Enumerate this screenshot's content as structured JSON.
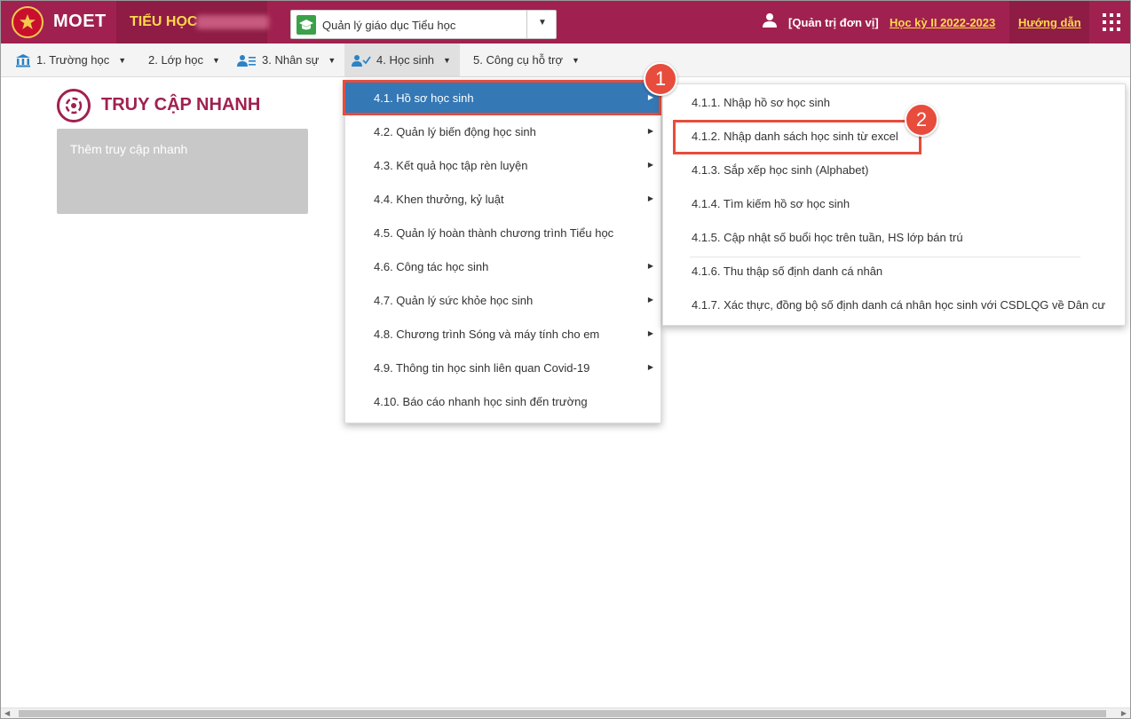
{
  "header": {
    "brand": "MOET",
    "school_level": "TIỂU HỌC",
    "app_select": "Quản lý giáo dục Tiểu học",
    "user_role": "[Quản trị đơn vị]",
    "semester": "Học kỳ II 2022-2023",
    "guide": "Hướng dẫn",
    "colors": {
      "primary": "#a0214f",
      "accent": "#ffd84a"
    }
  },
  "nav": {
    "items": [
      {
        "label": "1. Trường học",
        "icon": "school-icon"
      },
      {
        "label": "2. Lớp học",
        "icon": ""
      },
      {
        "label": "3. Nhân sự",
        "icon": "staff-icon"
      },
      {
        "label": "4. Học sinh",
        "icon": "student-icon"
      },
      {
        "label": "5. Công cụ hỗ trợ",
        "icon": ""
      }
    ]
  },
  "quick_access": {
    "title": "TRUY CẬP NHANH",
    "add_label": "Thêm truy cập nhanh"
  },
  "menu_students": {
    "items": [
      {
        "label": "4.1. Hồ sơ học sinh",
        "has_sub": true,
        "selected": true
      },
      {
        "label": "4.2. Quản lý biến động học sinh",
        "has_sub": true
      },
      {
        "label": "4.3. Kết quả học tập rèn luyện",
        "has_sub": true
      },
      {
        "label": "4.4. Khen thưởng, kỷ luật",
        "has_sub": true
      },
      {
        "label": "4.5. Quản lý hoàn thành chương trình Tiểu học",
        "has_sub": false
      },
      {
        "label": "4.6. Công tác học sinh",
        "has_sub": true
      },
      {
        "label": "4.7. Quản lý sức khỏe học sinh",
        "has_sub": true
      },
      {
        "label": "4.8. Chương trình Sóng và máy tính cho em",
        "has_sub": true
      },
      {
        "label": "4.9. Thông tin học sinh liên quan Covid-19",
        "has_sub": true
      },
      {
        "label": "4.10. Báo cáo nhanh học sinh đến trường",
        "has_sub": false
      }
    ]
  },
  "submenu_records": {
    "items": [
      {
        "label": "4.1.1. Nhập hồ sơ học sinh"
      },
      {
        "label": "4.1.2. Nhập danh sách học sinh từ excel"
      },
      {
        "label": "4.1.3. Sắp xếp học sinh (Alphabet)"
      },
      {
        "label": "4.1.4. Tìm kiếm hồ sơ học sinh"
      },
      {
        "label": "4.1.5. Cập nhật số buổi học trên tuần, HS lớp bán trú"
      },
      {
        "label": "4.1.6. Thu thập số định danh cá nhân"
      },
      {
        "label": "4.1.7. Xác thực, đồng bộ số định danh cá nhân học sinh với CSDLQG về Dân cư"
      }
    ]
  },
  "annotations": {
    "step1": "1",
    "step2": "2",
    "highlight_color": "#e74c3c"
  }
}
